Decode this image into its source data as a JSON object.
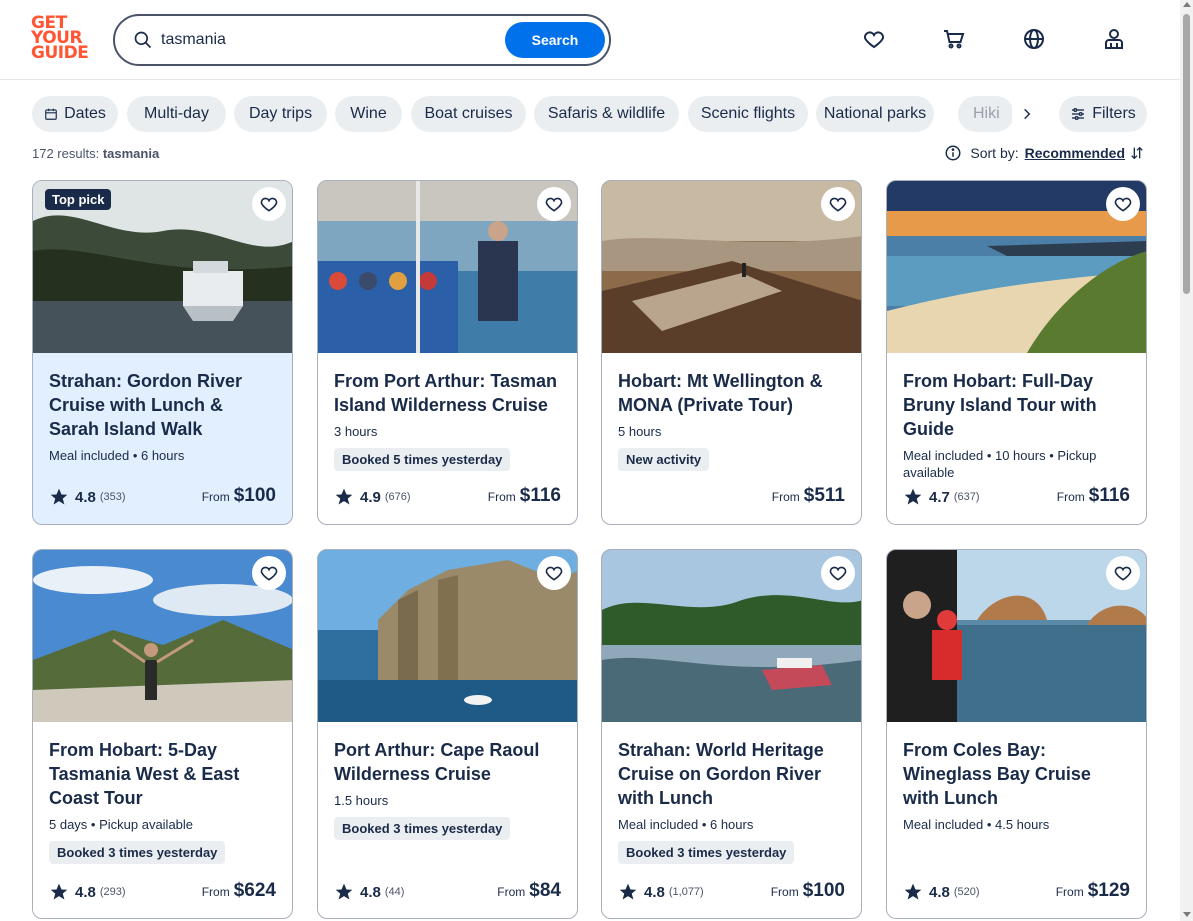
{
  "header": {
    "logo_lines": [
      "GET",
      "YOUR",
      "GUIDE"
    ],
    "search_value": "tasmania",
    "search_button": "Search"
  },
  "chips": {
    "items": [
      "Dates",
      "Multi-day",
      "Day trips",
      "Wine",
      "Boat cruises",
      "Safaris & wildlife",
      "Scenic flights",
      "National parks",
      "Hiki"
    ],
    "filters": "Filters"
  },
  "results": {
    "count": "172 results:",
    "query": "tasmania"
  },
  "sort": {
    "label": "Sort by:",
    "value": "Recommended"
  },
  "cards": [
    {
      "title": "Strahan: Gordon River Cruise with Lunch & Sarah Island Walk",
      "meta": "Meal included • 6 hours",
      "tag": "",
      "badge": "Top pick",
      "rating": "4.8",
      "reviews": "(353)",
      "from": "From",
      "price": "$100"
    },
    {
      "title": "From Port Arthur: Tasman Island Wilderness Cruise",
      "meta": "3 hours",
      "tag": "Booked 5 times yesterday",
      "badge": "",
      "rating": "4.9",
      "reviews": "(676)",
      "from": "From",
      "price": "$116"
    },
    {
      "title": "Hobart: Mt Wellington & MONA (Private Tour)",
      "meta": "5 hours",
      "tag": "New activity",
      "badge": "",
      "rating": "",
      "reviews": "",
      "from": "From",
      "price": "$511"
    },
    {
      "title": "From Hobart: Full-Day Bruny Island Tour with Guide",
      "meta": "Meal included • 10 hours • Pickup available",
      "tag": "",
      "badge": "",
      "rating": "4.7",
      "reviews": "(637)",
      "from": "From",
      "price": "$116"
    },
    {
      "title": "From Hobart: 5-Day Tasmania West & East Coast Tour",
      "meta": "5 days • Pickup available",
      "tag": "Booked 3 times yesterday",
      "badge": "",
      "rating": "4.8",
      "reviews": "(293)",
      "from": "From",
      "price": "$624"
    },
    {
      "title": "Port Arthur: Cape Raoul Wilderness Cruise",
      "meta": "1.5 hours",
      "tag": "Booked 3 times yesterday",
      "badge": "",
      "rating": "4.8",
      "reviews": "(44)",
      "from": "From",
      "price": "$84"
    },
    {
      "title": "Strahan: World Heritage Cruise on Gordon River with Lunch",
      "meta": "Meal included • 6 hours",
      "tag": "Booked 3 times yesterday",
      "badge": "",
      "rating": "4.8",
      "reviews": "(1,077)",
      "from": "From",
      "price": "$100"
    },
    {
      "title": "From Coles Bay: Wineglass Bay Cruise with Lunch",
      "meta": "Meal included • 4.5 hours",
      "tag": "",
      "badge": "",
      "rating": "4.8",
      "reviews": "(520)",
      "from": "From",
      "price": "$129"
    }
  ],
  "colors": {
    "brand": "#ff5533",
    "primary": "#0071eb",
    "text": "#1a2b49",
    "highlight_card": "#e1effe"
  }
}
